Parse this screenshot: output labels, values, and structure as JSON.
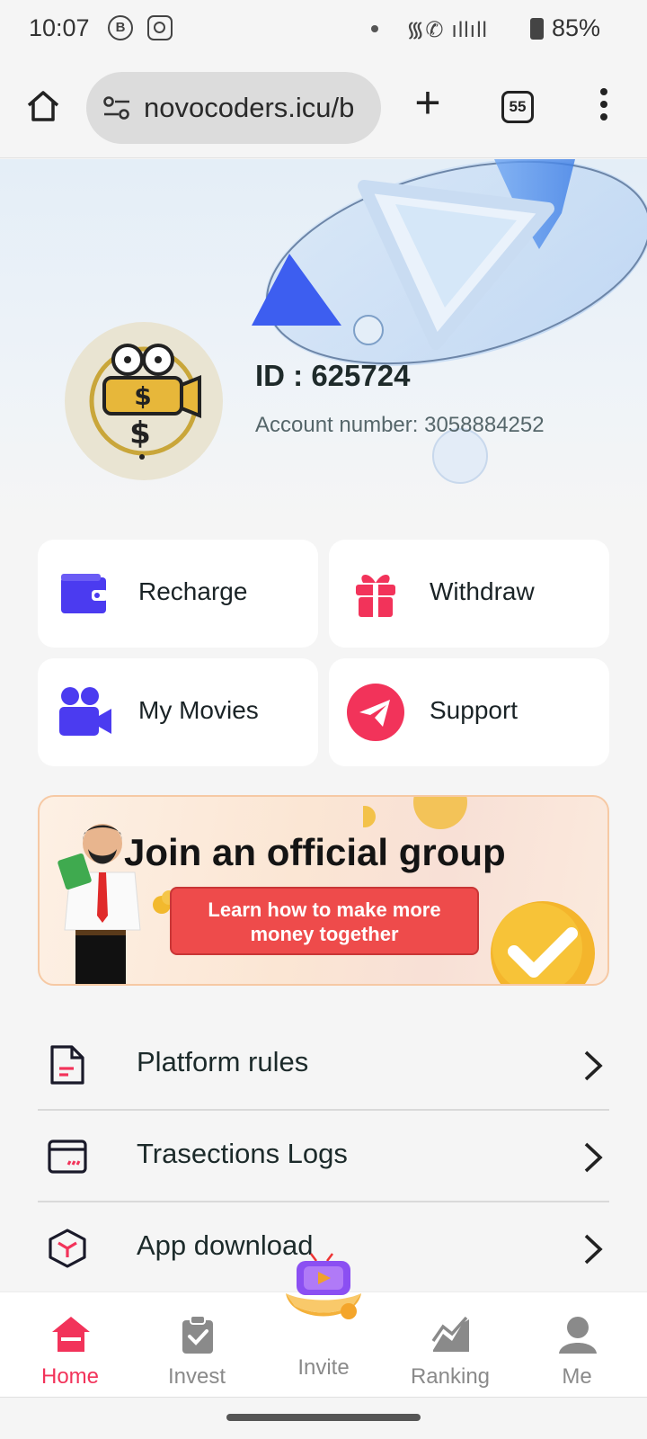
{
  "status_bar": {
    "time": "10:07",
    "app_icon_1": "B",
    "signal_icons": "᯾✆ ıllıll",
    "battery": "85%"
  },
  "browser": {
    "url": "novocoders.icu/b",
    "tab_count": "55"
  },
  "profile": {
    "id_text": "ID : 625724",
    "account_label": "Account number: ",
    "account_number": "3058884252"
  },
  "actions": [
    {
      "label": "Recharge",
      "icon": "wallet-icon",
      "color": "#4b3bf0"
    },
    {
      "label": "Withdraw",
      "icon": "gift-icon",
      "color": "#f2335a"
    },
    {
      "label": "My Movies",
      "icon": "video-camera-icon",
      "color": "#4b3bf0"
    },
    {
      "label": "Support",
      "icon": "paper-plane-icon",
      "color": "#f2335a"
    }
  ],
  "banner": {
    "title": "Join an official group",
    "button_line1": "Learn how to make more",
    "button_line2": "money together"
  },
  "menu": [
    {
      "label": "Platform rules",
      "icon": "document-icon"
    },
    {
      "label": "Trasections Logs",
      "icon": "card-icon"
    },
    {
      "label": "App download",
      "icon": "cube-icon"
    }
  ],
  "bottom_nav": [
    {
      "label": "Home",
      "icon": "home-icon",
      "active": true
    },
    {
      "label": "Invest",
      "icon": "clipboard-check-icon"
    },
    {
      "label": "Invite",
      "icon": "tv-gift-icon"
    },
    {
      "label": "Ranking",
      "icon": "chart-icon"
    },
    {
      "label": "Me",
      "icon": "user-icon"
    }
  ],
  "colors": {
    "accent_red": "#f2335a",
    "accent_blue": "#4b3bf0",
    "banner_button": "#ee4b4b"
  }
}
